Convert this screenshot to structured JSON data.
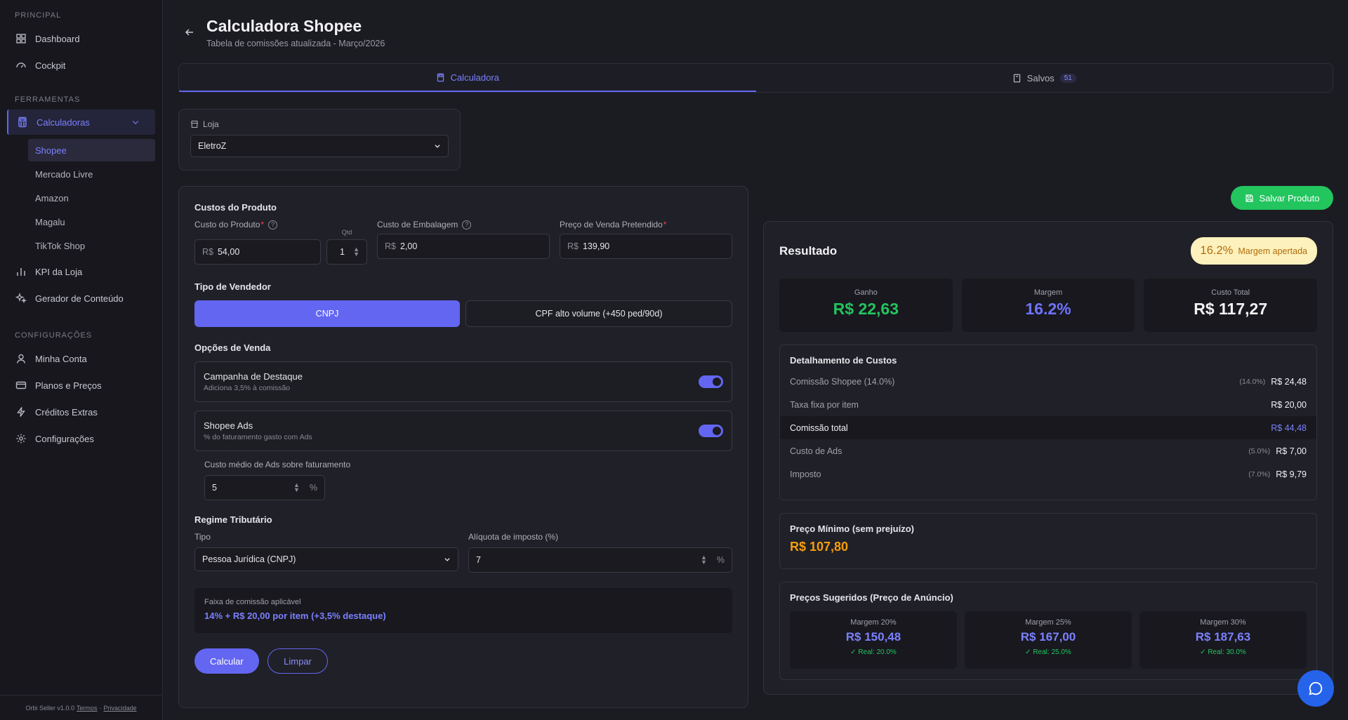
{
  "sidebar": {
    "section_principal": "PRINCIPAL",
    "dashboard": "Dashboard",
    "cockpit": "Cockpit",
    "section_ferramentas": "FERRAMENTAS",
    "calculadoras": "Calculadoras",
    "sub": [
      "Shopee",
      "Mercado Livre",
      "Amazon",
      "Magalu",
      "TikTok Shop"
    ],
    "kpi": "KPI da Loja",
    "gerador": "Gerador de Conteúdo",
    "section_config": "CONFIGURAÇÕES",
    "minha_conta": "Minha Conta",
    "planos": "Planos e Preços",
    "creditos": "Créditos Extras",
    "configuracoes": "Configurações",
    "footer_version": "Orbi Seller v1.0.0",
    "footer_terms": "Termos",
    "footer_sep": "·",
    "footer_privacy": "Privacidade"
  },
  "header": {
    "title": "Calculadora Shopee",
    "subtitle": "Tabela de comissões atualizada - Março/2026"
  },
  "tabs": {
    "calc": "Calculadora",
    "saved": "Salvos",
    "saved_count": "51"
  },
  "store": {
    "label": "Loja",
    "value": "EletroZ"
  },
  "costs": {
    "heading": "Custos do Produto",
    "product_label": "Custo do Produto",
    "req": "*",
    "help": "?",
    "currency": "R$",
    "product_value": "54,00",
    "qty_label": "Qtd",
    "qty_value": "1",
    "pack_label": "Custo de Embalagem",
    "pack_value": "2,00",
    "price_label": "Preço de Venda Pretendido",
    "price_value": "139,90"
  },
  "seller": {
    "heading": "Tipo de Vendedor",
    "opt1": "CNPJ",
    "opt2": "CPF alto volume (+450 ped/90d)"
  },
  "sale": {
    "heading": "Opções de Venda",
    "camp_title": "Campanha de Destaque",
    "camp_sub": "Adiciona 3,5% à comissão",
    "ads_title": "Shopee Ads",
    "ads_sub": "% do faturamento gasto com Ads",
    "ads_cost_label": "Custo médio de Ads sobre faturamento",
    "ads_cost_value": "5",
    "pct": "%"
  },
  "tax": {
    "heading": "Regime Tributário",
    "type_label": "Tipo",
    "type_value": "Pessoa Jurídica (CNPJ)",
    "rate_label": "Alíquota de imposto (%)",
    "rate_value": "7"
  },
  "faixa": {
    "label": "Faixa de comissão aplicável",
    "value": "14% + R$ 20,00 por item (+3,5% destaque)"
  },
  "actions": {
    "calc": "Calcular",
    "clear": "Limpar",
    "save": "Salvar Produto"
  },
  "result": {
    "title": "Resultado",
    "badge_pct": "16.2%",
    "badge_text": "Margem apertada",
    "stats": [
      {
        "k": "Ganho",
        "v": "R$ 22,63"
      },
      {
        "k": "Margem",
        "v": "16.2%"
      },
      {
        "k": "Custo Total",
        "v": "R$ 117,27"
      }
    ],
    "det_title": "Detalhamento de Custos",
    "rows": [
      {
        "label": "Comissão Shopee (14.0%)",
        "pct": "(14.0%)",
        "val": "R$ 24,48"
      },
      {
        "label": "Taxa fixa por item",
        "pct": "",
        "val": "R$ 20,00"
      },
      {
        "label": "Comissão total",
        "pct": "",
        "val": "R$ 44,48"
      },
      {
        "label": "Custo de Ads",
        "pct": "(5.0%)",
        "val": "R$ 7,00"
      },
      {
        "label": "Imposto",
        "pct": "(7.0%)",
        "val": "R$ 9,79"
      }
    ],
    "min_title": "Preço Mínimo (sem prejuízo)",
    "min_value": "R$ 107,80",
    "sug_title": "Preços Sugeridos (Preço de Anúncio)",
    "sug": [
      {
        "k": "Margem 20%",
        "v": "R$ 150,48",
        "r": "✓ Real: 20.0%"
      },
      {
        "k": "Margem 25%",
        "v": "R$ 167,00",
        "r": "✓ Real: 25.0%"
      },
      {
        "k": "Margem 30%",
        "v": "R$ 187,63",
        "r": "✓ Real: 30.0%"
      }
    ]
  },
  "colors": {
    "accent": "#6366f1",
    "success": "#22c55e",
    "warning": "#f59e0b",
    "chat": "#2563eb"
  }
}
